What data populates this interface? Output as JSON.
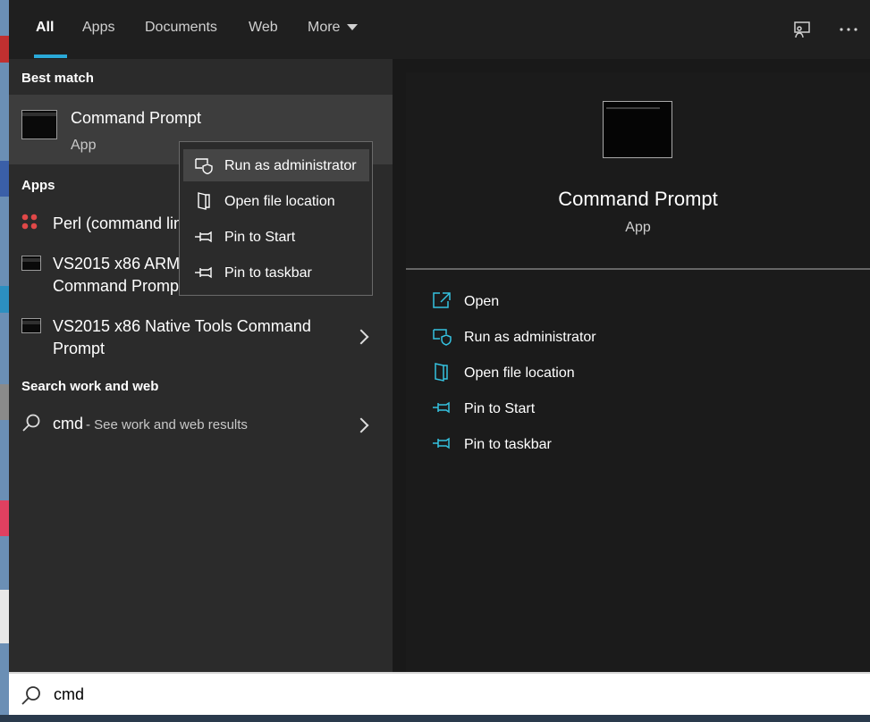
{
  "tabs": {
    "items": [
      "All",
      "Apps",
      "Documents",
      "Web",
      "More"
    ],
    "active": "All"
  },
  "toolbar": {
    "feedback_icon": "feedback-icon",
    "more_icon": "more-options-icon"
  },
  "results": {
    "best_match_heading": "Best match",
    "best_match": {
      "title": "Command Prompt",
      "subtitle": "App"
    },
    "apps_heading": "Apps",
    "apps": [
      {
        "label": "Perl (command lin"
      },
      {
        "line1": "VS2015 x86 ARM",
        "line2": "Command Promp"
      },
      {
        "line1": "VS2015 x86 Native Tools Command",
        "line2": "Prompt"
      }
    ],
    "web_heading": "Search work and web",
    "web": {
      "query": "cmd",
      "suffix": " - See work and web results"
    }
  },
  "context_menu": {
    "items": [
      "Run as administrator",
      "Open file location",
      "Pin to Start",
      "Pin to taskbar"
    ]
  },
  "preview": {
    "title": "Command Prompt",
    "subtitle": "App",
    "actions": [
      "Open",
      "Run as administrator",
      "Open file location",
      "Pin to Start",
      "Pin to taskbar"
    ]
  },
  "search": {
    "value": "cmd"
  },
  "colors": {
    "accent": "#2aa9d8",
    "action_icon": "#35c2e0"
  }
}
